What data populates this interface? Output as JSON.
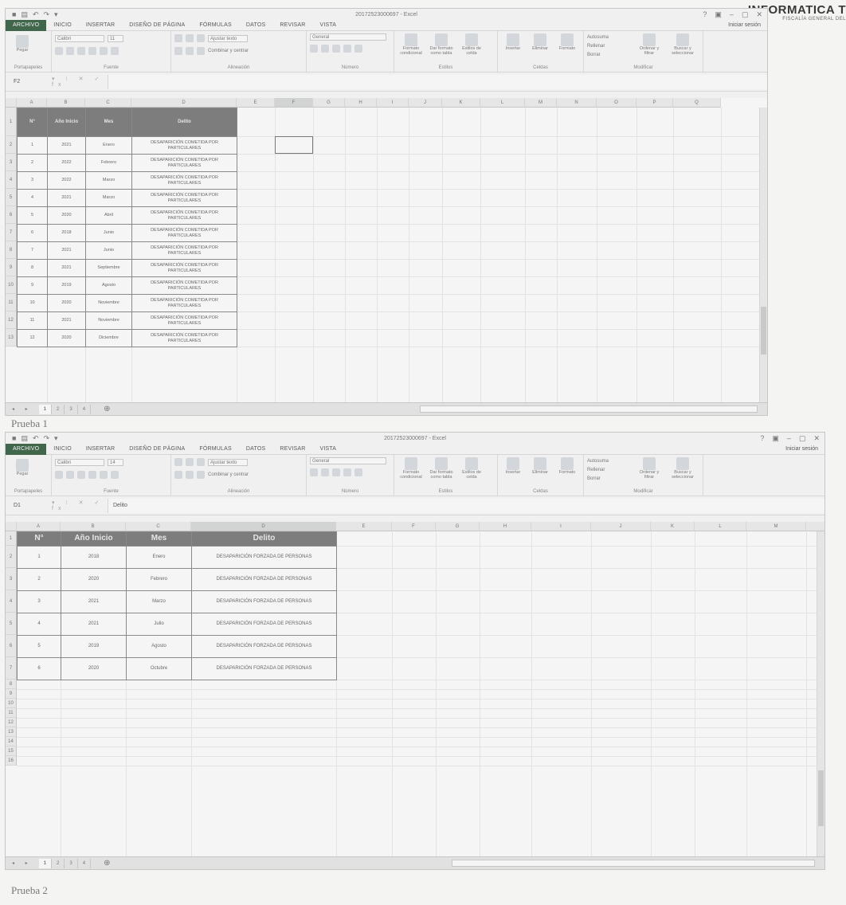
{
  "header": {
    "title": "INFORMATICA T",
    "subtitle": "FISCALÍA GENERAL DEL"
  },
  "captions": {
    "first": "Prueba 1",
    "second": "Prueba 2"
  },
  "window1": {
    "title": "20172523000697 - Excel",
    "quick_access": [
      "■",
      "▤",
      "↶",
      "↷",
      "▾"
    ],
    "controls": [
      "?",
      "▣",
      "–",
      "▢",
      "✕"
    ],
    "menu": [
      "ARCHIVO",
      "INICIO",
      "INSERTAR",
      "DISEÑO DE PÁGINA",
      "FÓRMULAS",
      "DATOS",
      "REVISAR",
      "VISTA"
    ],
    "signin": "Iniciar sesión",
    "ribbon": {
      "clipboard": {
        "paste": "Pegar",
        "label": "Portapapeles"
      },
      "font": {
        "name": "Calibri",
        "size": "11",
        "label": "Fuente"
      },
      "align": {
        "wrap": "Ajustar texto",
        "merge": "Combinar y centrar",
        "label": "Alineación"
      },
      "number": {
        "format": "General",
        "label": "Número"
      },
      "styles": {
        "b1": "Formato condicional",
        "b2": "Dar formato como tabla",
        "b3": "Estilos de celda",
        "label": "Estilos"
      },
      "cells": {
        "b1": "Insertar",
        "b2": "Eliminar",
        "b3": "Formato",
        "label": "Celdas"
      },
      "edit": {
        "autosum": "Autosuma",
        "fill": "Rellenar",
        "clear": "Borrar",
        "sort": "Ordenar y filtrar",
        "find": "Buscar y seleccionar",
        "label": "Modificar"
      }
    },
    "namebox": "F2",
    "formula": "",
    "columns": [
      "A",
      "B",
      "C",
      "D",
      "E",
      "F",
      "G",
      "H",
      "I",
      "J",
      "K",
      "L",
      "M",
      "N",
      "O",
      "P",
      "Q"
    ],
    "headers": [
      "N°",
      "Año Inicio",
      "Mes",
      "Delito"
    ],
    "rows": [
      [
        "1",
        "2021",
        "Enero",
        "DESAPARICIÓN COMETIDA POR PARTICULARES"
      ],
      [
        "2",
        "2022",
        "Febrero",
        "DESAPARICIÓN COMETIDA POR PARTICULARES"
      ],
      [
        "3",
        "2022",
        "Marzo",
        "DESAPARICIÓN COMETIDA POR PARTICULARES"
      ],
      [
        "4",
        "2021",
        "Marzo",
        "DESAPARICIÓN COMETIDA POR PARTICULARES"
      ],
      [
        "5",
        "2020",
        "Abril",
        "DESAPARICIÓN COMETIDA POR PARTICULARES"
      ],
      [
        "6",
        "2018",
        "Junio",
        "DESAPARICIÓN COMETIDA POR PARTICULARES"
      ],
      [
        "7",
        "2021",
        "Junio",
        "DESAPARICIÓN COMETIDA POR PARTICULARES"
      ],
      [
        "8",
        "2021",
        "Septiembre",
        "DESAPARICIÓN COMETIDA POR PARTICULARES"
      ],
      [
        "9",
        "2019",
        "Agosto",
        "DESAPARICIÓN COMETIDA POR PARTICULARES"
      ],
      [
        "10",
        "2020",
        "Noviembre",
        "DESAPARICIÓN COMETIDA POR PARTICULARES"
      ],
      [
        "11",
        "2021",
        "Noviembre",
        "DESAPARICIÓN COMETIDA POR PARTICULARES"
      ],
      [
        "12",
        "2020",
        "Diciembre",
        "DESAPARICIÓN COMETIDA POR PARTICULARES"
      ]
    ],
    "row_numbers": [
      "1",
      "2",
      "3",
      "4",
      "5",
      "6",
      "7",
      "8",
      "9",
      "10",
      "11",
      "12",
      "13"
    ],
    "sheets": [
      "1",
      "2",
      "3",
      "4"
    ],
    "add_sheet": "⊕",
    "sheet_nav": "◂ ▸"
  },
  "window2": {
    "title": "20172523000697 - Excel",
    "quick_access": [
      "■",
      "▤",
      "↶",
      "↷",
      "▾"
    ],
    "controls": [
      "?",
      "▣",
      "–",
      "▢",
      "✕"
    ],
    "menu": [
      "ARCHIVO",
      "INICIO",
      "INSERTAR",
      "DISEÑO DE PÁGINA",
      "FÓRMULAS",
      "DATOS",
      "REVISAR",
      "VISTA"
    ],
    "signin": "Iniciar sesión",
    "ribbon": {
      "clipboard": {
        "paste": "Pegar",
        "label": "Portapapeles"
      },
      "font": {
        "name": "Calibri",
        "size": "14",
        "label": "Fuente"
      },
      "align": {
        "wrap": "Ajustar texto",
        "merge": "Combinar y centrar",
        "label": "Alineación"
      },
      "number": {
        "format": "General",
        "label": "Número"
      },
      "styles": {
        "b1": "Formato condicional",
        "b2": "Dar formato como tabla",
        "b3": "Estilos de celda",
        "label": "Estilos"
      },
      "cells": {
        "b1": "Insertar",
        "b2": "Eliminar",
        "b3": "Formato",
        "label": "Celdas"
      },
      "edit": {
        "autosum": "Autosuma",
        "fill": "Rellenar",
        "clear": "Borrar",
        "sort": "Ordenar y filtrar",
        "find": "Buscar y seleccionar",
        "label": "Modificar"
      }
    },
    "namebox": "D1",
    "formula": "Delito",
    "columns": [
      "A",
      "B",
      "C",
      "D",
      "E",
      "F",
      "G",
      "H",
      "I",
      "J",
      "K",
      "L",
      "M",
      "N"
    ],
    "headers": [
      "N°",
      "Año Inicio",
      "Mes",
      "Delito"
    ],
    "rows": [
      [
        "1",
        "2018",
        "Enero",
        "DESAPARICIÓN FORZADA DE PERSONAS"
      ],
      [
        "2",
        "2020",
        "Febrero",
        "DESAPARICIÓN FORZADA DE PERSONAS"
      ],
      [
        "3",
        "2021",
        "Marzo",
        "DESAPARICIÓN FORZADA DE PERSONAS"
      ],
      [
        "4",
        "2021",
        "Julio",
        "DESAPARICIÓN FORZADA DE PERSONAS"
      ],
      [
        "5",
        "2019",
        "Agosto",
        "DESAPARICIÓN FORZADA DE PERSONAS"
      ],
      [
        "6",
        "2020",
        "Octubre",
        "DESAPARICIÓN FORZADA DE PERSONAS"
      ]
    ],
    "row_numbers": [
      "1",
      "2",
      "3",
      "4",
      "5",
      "6",
      "7",
      "8",
      "9",
      "10",
      "11",
      "12",
      "13",
      "14",
      "15",
      "16"
    ],
    "sheets": [
      "1",
      "2",
      "3",
      "4"
    ],
    "add_sheet": "⊕",
    "sheet_nav": "◂ ▸"
  }
}
